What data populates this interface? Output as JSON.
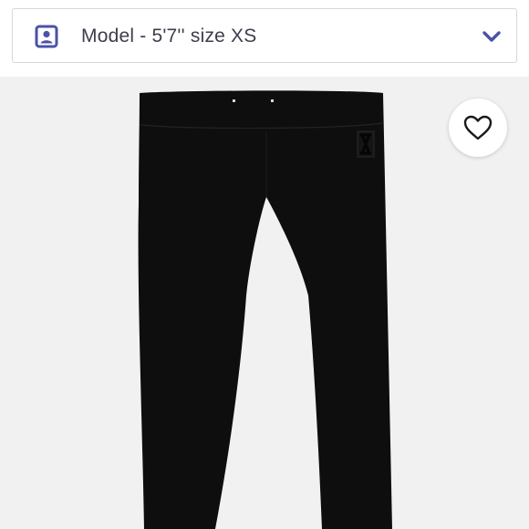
{
  "model_selector": {
    "label": "Model - 5'7'' size XS",
    "icon": "person-portrait-icon",
    "dropdown_icon": "chevron-down-icon",
    "accent_color": "#4a52a8"
  },
  "product_image": {
    "subject": "black leggings",
    "background_color": "#f1f1f1",
    "garment_color": "#0e0e0e"
  },
  "like_button": {
    "icon": "heart-outline-icon"
  }
}
